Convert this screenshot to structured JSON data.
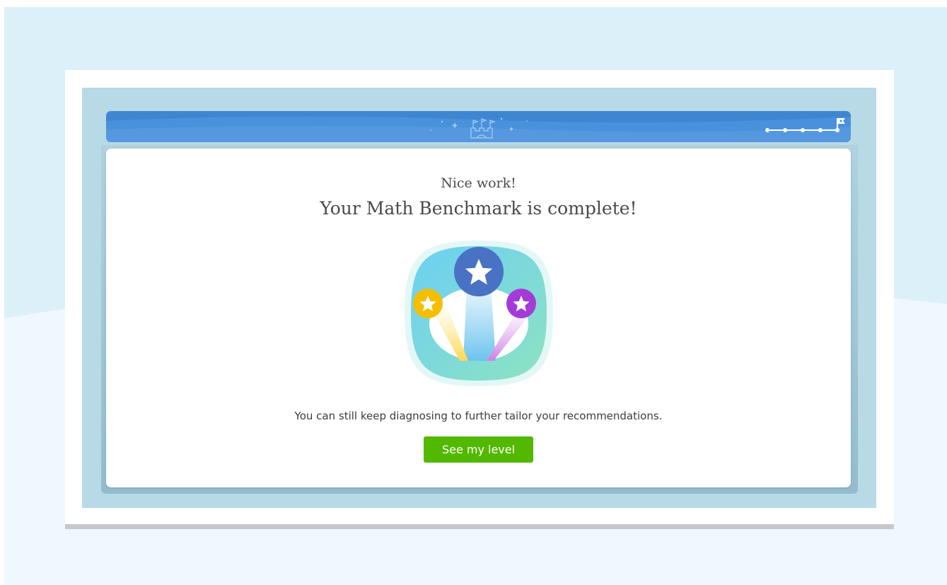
{
  "completion": {
    "subtitle": "Nice work!",
    "title": "Your Math Benchmark is complete!",
    "message": "You can still keep diagnosing to further tailor your recommendations.",
    "cta_label": "See my level"
  },
  "progress": {
    "steps_total": 5,
    "steps_completed": 5
  },
  "colors": {
    "accent_green": "#53b800",
    "header_blue": "#4a8fd8",
    "star_blue": "#4a72c4",
    "star_yellow": "#f5be00",
    "star_purple": "#a53bd6"
  },
  "icons": {
    "header_center": "castle-icon",
    "progress_end": "flag-icon",
    "badge": "stars-badge-icon"
  }
}
